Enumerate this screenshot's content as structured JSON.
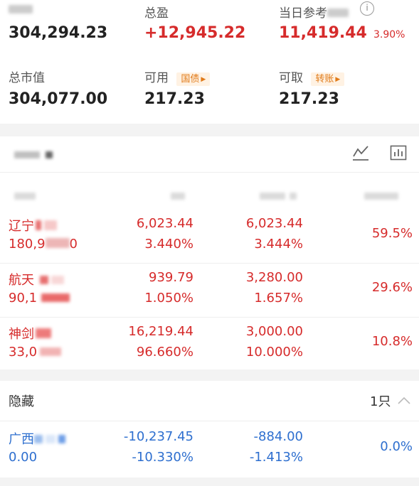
{
  "summary": {
    "total_assets_label": "",
    "total_assets_value": "304,294.23",
    "total_pnl_label": "总盈",
    "total_pnl_value": "+12,945.22",
    "daily_pnl_label": "当日参考",
    "daily_pnl_value": "11,419.44",
    "daily_pnl_pct": "3.90%",
    "market_value_label": "总市值",
    "market_value_value": "304,077.00",
    "available_label": "可用",
    "available_value": "217.23",
    "available_tag": "国债",
    "withdrawable_label": "可取",
    "withdrawable_value": "217.23",
    "withdrawable_tag": "转账"
  },
  "holdings": {
    "title": "",
    "rows": [
      {
        "name": "辽宁",
        "qty": "180,9",
        "qty_tail": "0",
        "price": "6,023.44",
        "price_pct": "3.440%",
        "cost": "6,023.44",
        "cost_pct": "3.444%",
        "ratio": "59.5%"
      },
      {
        "name": "航天",
        "qty": "90,1",
        "qty_tail": "",
        "price": "939.79",
        "price_pct": "1.050%",
        "cost": "3,280.00",
        "cost_pct": "1.657%",
        "ratio": "29.6%"
      },
      {
        "name": "神剑",
        "qty": "33,0",
        "qty_tail": "",
        "price": "16,219.44",
        "price_pct": "96.660%",
        "cost": "3,000.00",
        "cost_pct": "10.000%",
        "ratio": "10.8%"
      }
    ]
  },
  "hidden": {
    "title": "隐藏",
    "count": "1只",
    "rows": [
      {
        "name": "广西",
        "qty": "0.00",
        "price": "-10,237.45",
        "price_pct": "-10.330%",
        "cost": "-884.00",
        "cost_pct": "-1.413%",
        "ratio": "0.0%"
      }
    ]
  },
  "icons": {
    "info": "info-icon",
    "chart": "line-chart-icon",
    "bars": "bar-chart-icon",
    "chevron": "chevron-up-icon"
  },
  "colors": {
    "positive": "#d62b2b",
    "negative": "#2e6fcf",
    "tag_text": "#e07a18"
  }
}
